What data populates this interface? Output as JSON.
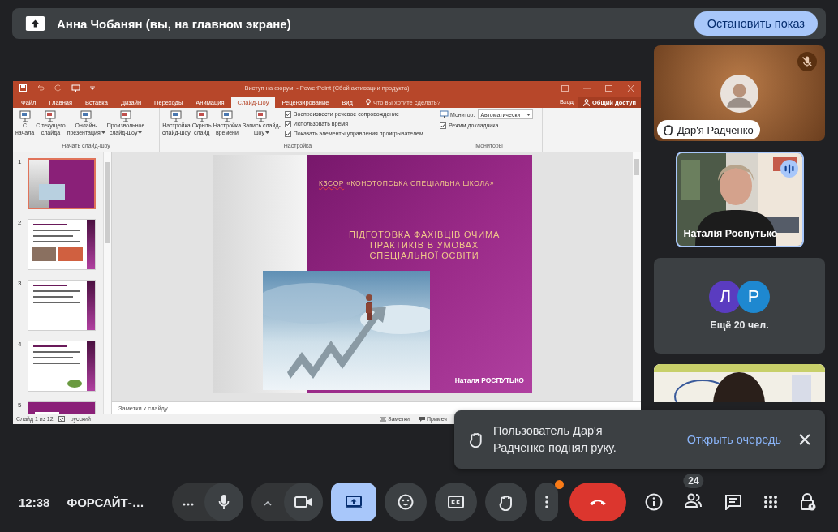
{
  "share_bar": {
    "title": "Анна Чобанян (вы, на главном экране)",
    "stop_button": "Остановить показ"
  },
  "powerpoint": {
    "window_title": "Виступ на форумі - PowerPoint (Сбой активации продукта)",
    "tabs": [
      {
        "label": "Файл",
        "selected": false
      },
      {
        "label": "Главная",
        "selected": false
      },
      {
        "label": "Вставка",
        "selected": false
      },
      {
        "label": "Дизайн",
        "selected": false
      },
      {
        "label": "Переходы",
        "selected": false
      },
      {
        "label": "Анимация",
        "selected": false
      },
      {
        "label": "Слайд-шоу",
        "selected": true
      },
      {
        "label": "Рецензирование",
        "selected": false
      },
      {
        "label": "Вид",
        "selected": false
      }
    ],
    "tell_me": "Что вы хотите сделать?",
    "sign_in": "Вход",
    "share": "Общий доступ",
    "groups": [
      {
        "label": "Начать слайд-шоу",
        "buttons": [
          {
            "label": "С\nначала",
            "dropdown": false
          },
          {
            "label": "С текущего\nслайда",
            "dropdown": false
          },
          {
            "label": "Онлайн-\nпрезентация",
            "dropdown": true
          },
          {
            "label": "Произвольное\nслайд-шоу",
            "dropdown": true
          }
        ]
      },
      {
        "label": "Настройка",
        "buttons": [
          {
            "label": "Настройка\nслайд-шоу",
            "dropdown": false
          },
          {
            "label": "Скрыть\nслайд",
            "dropdown": false
          },
          {
            "label": "Настройка\nвремени",
            "dropdown": false
          },
          {
            "label": "Запись слайд-\nшоу",
            "dropdown": true
          }
        ],
        "checkboxes": [
          {
            "label": "Воспроизвести речевое сопровождение",
            "checked": true
          },
          {
            "label": "Использовать время",
            "checked": true
          },
          {
            "label": "Показать элементы управления проигрывателем",
            "checked": true
          }
        ]
      },
      {
        "label": "Мониторы",
        "monitor_label": "Монитор:",
        "monitor_value": "Автоматически",
        "checkboxes": [
          {
            "label": "Режим докладчика",
            "checked": true
          }
        ]
      }
    ],
    "thumbnails": [
      {
        "number": "1",
        "kind": "title",
        "selected": true
      },
      {
        "number": "2",
        "kind": "photos",
        "selected": false
      },
      {
        "number": "3",
        "kind": "text",
        "selected": false
      },
      {
        "number": "4",
        "kind": "list",
        "selected": false
      },
      {
        "number": "5",
        "kind": "cover",
        "selected": false
      }
    ],
    "slide": {
      "school_abbr": "КЗСОР",
      "school_name": "«КОНОТОПСЬКА СПЕЦІАЛЬНА ШКОЛА»",
      "title": "ПІДГОТОВКА ФАХІВЦІВ ОЧИМА ПРАКТИКІВ В УМОВАХ СПЕЦІАЛЬНОЇ ОСВІТИ",
      "author": "Наталя РОСПУТЬКО"
    },
    "notes_placeholder": "Заметки к слайду",
    "status": {
      "slide": "Слайд 1 из 12",
      "language": "русский",
      "notes": "Заметки",
      "comments": "Примеч"
    }
  },
  "tiles": [
    {
      "kind": "avatar",
      "name": "Дар'я Радченко",
      "muted": true,
      "hand_raised": true
    },
    {
      "kind": "video",
      "name": "Наталія Роспутько",
      "speaking": true
    },
    {
      "kind": "others",
      "avatars": [
        {
          "letter": "Л",
          "color": "#5a3cc0"
        },
        {
          "letter": "Р",
          "color": "#1e88d0"
        }
      ],
      "label": "Ещё 20 чел."
    },
    {
      "kind": "partial_video"
    }
  ],
  "toast": {
    "message": "Пользователь Дар'я Радченко поднял руку.",
    "action": "Открыть очередь"
  },
  "bottom_bar": {
    "time": "12:38",
    "meeting": "ФОРСАЙТ-…",
    "controls": [
      {
        "kind": "audio"
      },
      {
        "kind": "video"
      },
      {
        "kind": "present",
        "on": true
      },
      {
        "kind": "reactions",
        "on": false
      },
      {
        "kind": "captions",
        "on": false
      },
      {
        "kind": "hand",
        "on": false
      },
      {
        "kind": "more",
        "notification": true
      },
      {
        "kind": "leave"
      }
    ],
    "participants_count": "24"
  }
}
